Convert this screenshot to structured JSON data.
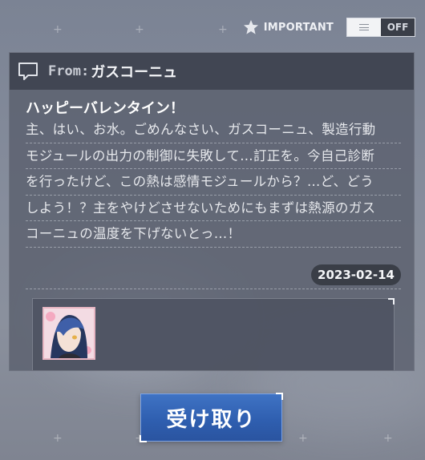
{
  "header": {
    "star_icon": "star-icon",
    "important_label": "IMPORTANT",
    "toggle": {
      "state": "OFF",
      "knob_icon": "menu-lines-icon"
    }
  },
  "mail": {
    "from_label": "From:",
    "from_name": "ガスコーニュ",
    "icon": "message-bubble-icon",
    "title": "ハッピーバレンタイン！",
    "body_lines": [
      "主、はい、お水。ごめんなさい、ガスコーニュ、製造行動",
      "モジュールの出力の制御に失敗して…訂正を。今自己診断",
      "を行ったけど、この熱は感情モジュールから？…ど、どう",
      "しよう！？主をやけどさせないためにもまずは熱源のガス",
      "コーニュの温度を下げないとっ…！"
    ],
    "date": "2023-02-14",
    "attachment": {
      "type": "character-portrait"
    }
  },
  "actions": {
    "receive_label": "受け取り"
  },
  "colors": {
    "accent_blue": "#2f5fb0",
    "card_bg": "#585e6c",
    "header_bg": "#3c414e"
  }
}
